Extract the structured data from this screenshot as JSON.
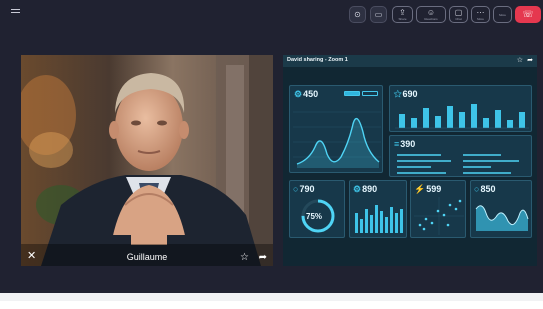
{
  "toolbar": {
    "buttons": [
      {
        "name": "shield-button",
        "glyph": "⊙",
        "label": ""
      },
      {
        "name": "camera-button",
        "glyph": "▭",
        "label": ""
      },
      {
        "name": "share-button",
        "glyph": "⇪",
        "label": "Share"
      },
      {
        "name": "reactions-button",
        "glyph": "☺",
        "label": "Reactions"
      },
      {
        "name": "chat-button",
        "glyph": "▢",
        "label": "Chat"
      },
      {
        "name": "more-button",
        "glyph": "⋯",
        "label": "More"
      },
      {
        "name": "people-button",
        "glyph": "",
        "label": "More"
      }
    ],
    "leave_icon": "☏"
  },
  "participant": {
    "name": "Guillaume",
    "close_icon": "✕",
    "star_icon": "☆",
    "share_icon": "➦"
  },
  "share": {
    "title": "David sharing - Zoom 1",
    "star_icon": "☆",
    "arrow_icon": "➦",
    "stats": {
      "s450": "450",
      "s690": "690",
      "s390": "390",
      "s790": "790",
      "s890": "890",
      "s599": "599",
      "s850": "850"
    },
    "donut_value": "75%",
    "donut_fraction": 0.75,
    "colors": {
      "accent": "#3ec4e8",
      "panel": "#17384a",
      "leave": "#e5384f"
    }
  }
}
